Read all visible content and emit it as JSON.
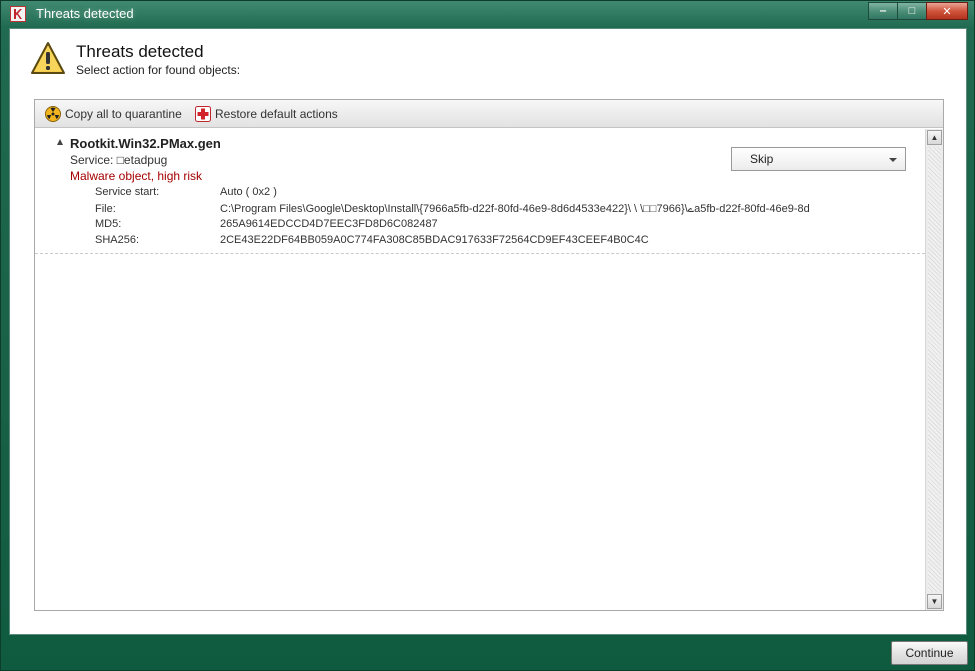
{
  "window": {
    "title": "Threats detected",
    "controls": {
      "minimize": "‒",
      "maximize": "□",
      "close": "✕"
    }
  },
  "header": {
    "title": "Threats detected",
    "subtitle": "Select action for found objects:",
    "icon": "warning-triangle-icon"
  },
  "toolbar": {
    "copy_quarantine": {
      "label": "Copy all to quarantine",
      "icon": "radiation-icon"
    },
    "restore_defaults": {
      "label": "Restore default actions",
      "icon": "red-cross-icon"
    }
  },
  "threats": [
    {
      "name": "Rootkit.Win32.PMax.gen",
      "service_label": "Service: ",
      "service_value": "□etadpug",
      "risk": "Malware object, high risk",
      "action": "Skip",
      "details": [
        {
          "key": "Service start:",
          "value": "Auto ( 0x2 )"
        },
        {
          "key": "File:",
          "value": "C:\\Program Files\\Google\\Desktop\\Install\\{7966a5fb-d22f-80fd-46e9-8d6d4533e422}\\   \\   \\□□‫ے‬\\{7966a5fb-d22f-80fd-46e9-8d"
        },
        {
          "key": "MD5:",
          "value": "265A9614EDCCD4D7EEC3FD8D6C082487"
        },
        {
          "key": "SHA256:",
          "value": "2CE43E22DF64BB059A0C774FA308C85BDAC917633F72564CD9EF43CEEF4B0C4C"
        }
      ]
    }
  ],
  "footer": {
    "continue_label": "Continue"
  },
  "colors": {
    "risk_text": "#a40000",
    "frame": "#1f6a50",
    "close_button": "#d1553d"
  }
}
